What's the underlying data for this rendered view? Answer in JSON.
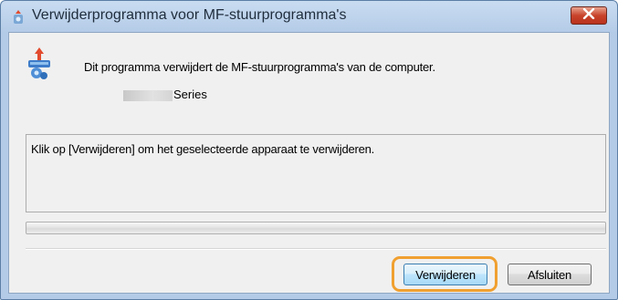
{
  "window": {
    "title": "Verwijderprogramma voor MF-stuurprogramma's",
    "close_icon": "close-icon"
  },
  "content": {
    "description": "Dit programma verwijdert de MF-stuurprogramma's van de computer.",
    "series_label": "Series",
    "message": "Klik op [Verwijderen] om het geselecteerde apparaat te verwijderen.",
    "progress_fraction": 0
  },
  "buttons": {
    "remove_label": "Verwijderen",
    "close_label": "Afsluiten"
  },
  "colors": {
    "highlight_ring": "#f0a030",
    "close_button": "#c9432b"
  }
}
